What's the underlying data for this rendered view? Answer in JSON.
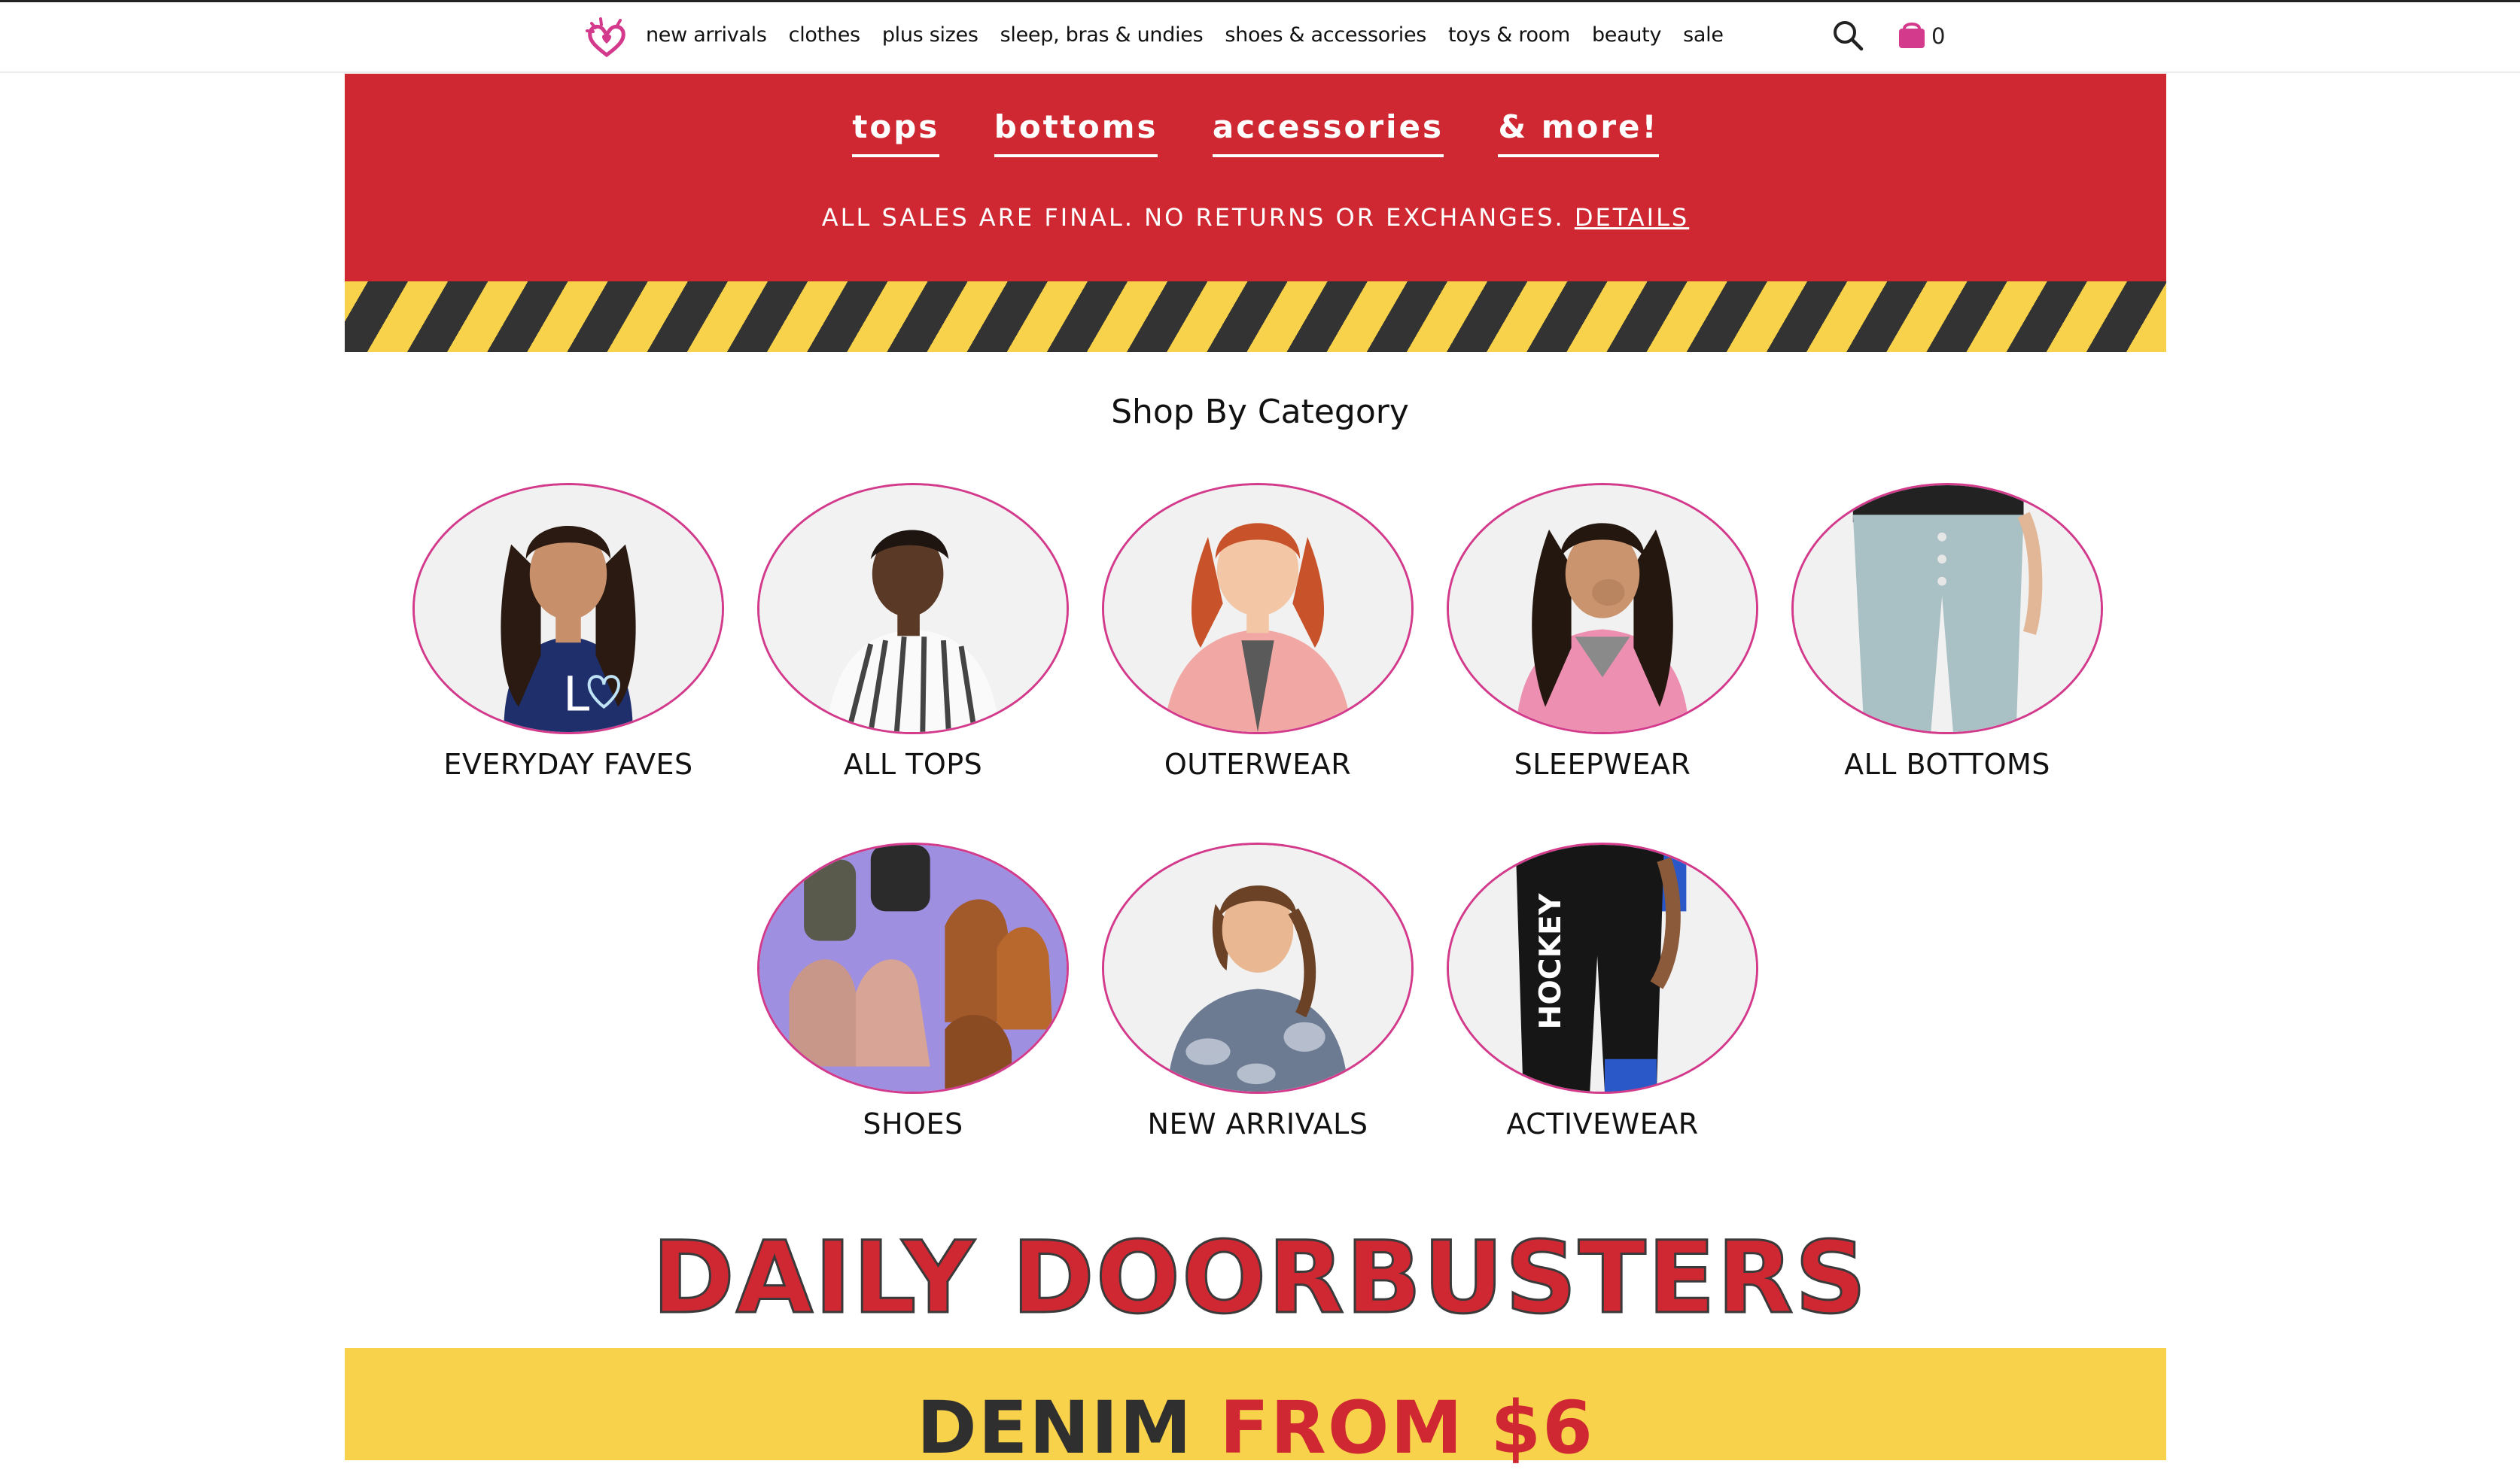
{
  "header": {
    "nav": [
      "new arrivals",
      "clothes",
      "plus sizes",
      "sleep, bras & undies",
      "shoes & accessories",
      "toys & room",
      "beauty",
      "sale"
    ],
    "cart_count": "0"
  },
  "sale_banner": {
    "tabs": [
      "tops",
      "bottoms",
      "accessories",
      "& more!"
    ],
    "note": "ALL SALES ARE FINAL. NO RETURNS OR EXCHANGES.",
    "details_link": "DETAILS"
  },
  "categories": {
    "title": "Shop By Category",
    "items": [
      "EVERYDAY FAVES",
      "ALL TOPS",
      "OUTERWEAR",
      "SLEEPWEAR",
      "ALL BOTTOMS",
      "SHOES",
      "NEW ARRIVALS",
      "ACTIVEWEAR"
    ]
  },
  "doorbusters": {
    "title": "DAILY DOORBUSTERS",
    "promo_part1": "DENIM",
    "promo_part2": "FROM $6"
  },
  "colors": {
    "brand_pink": "#d33a8c",
    "banner_red": "#cf2832",
    "caution_yellow": "#f7d24a",
    "caution_dark": "#333333"
  }
}
